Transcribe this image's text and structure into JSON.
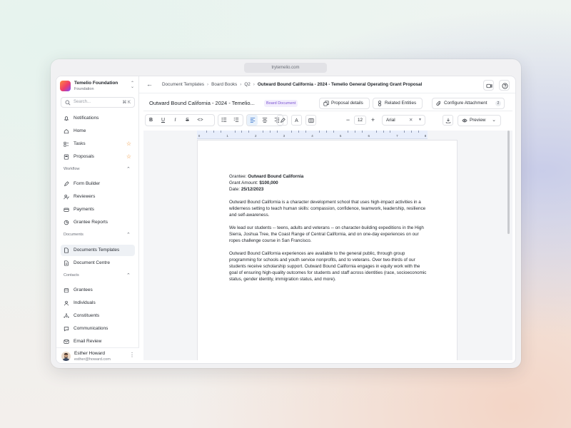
{
  "browser": {
    "url": "trytemelio.com"
  },
  "org": {
    "name": "Temelio Foundation",
    "subtitle": "Foundation"
  },
  "search": {
    "placeholder": "Search...",
    "shortcut": "⌘ K"
  },
  "sidebar": {
    "top_items": [
      {
        "label": "Notifications",
        "icon": "bell-icon"
      },
      {
        "label": "Home",
        "icon": "home-icon"
      },
      {
        "label": "Tasks",
        "icon": "tasks-icon",
        "starred": true
      },
      {
        "label": "Proposals",
        "icon": "proposals-icon",
        "starred": true
      }
    ],
    "sections": [
      {
        "title": "Workflow",
        "items": [
          {
            "label": "Form Builder",
            "icon": "form-builder-icon"
          },
          {
            "label": "Reviewers",
            "icon": "reviewers-icon"
          },
          {
            "label": "Payments",
            "icon": "payments-icon"
          },
          {
            "label": "Grantee Reports",
            "icon": "reports-icon"
          }
        ]
      },
      {
        "title": "Documents",
        "items": [
          {
            "label": "Documents Templates",
            "icon": "document-icon",
            "active": true
          },
          {
            "label": "Document Centre",
            "icon": "document-centre-icon"
          }
        ]
      },
      {
        "title": "Contacts",
        "items": [
          {
            "label": "Grantees",
            "icon": "grantees-icon"
          },
          {
            "label": "Individuals",
            "icon": "individuals-icon"
          },
          {
            "label": "Constituents",
            "icon": "constituents-icon"
          },
          {
            "label": "Communications",
            "icon": "communications-icon"
          },
          {
            "label": "Email Review",
            "icon": "email-icon"
          }
        ]
      }
    ]
  },
  "user": {
    "name": "Esther Howard",
    "email": "esther@howard.com"
  },
  "breadcrumb": [
    "Document Templates",
    "Board Books",
    "Q2",
    "Outward Bound California - 2024 - Temelio General Operating Grant Proposal"
  ],
  "document": {
    "title": "Outward Bound California - 2024 - Temelio...",
    "badge": "Board Document",
    "actions": {
      "proposal_details": "Proposal details",
      "related_entities": "Related Entities",
      "configure_attachment": "Configure Attachment",
      "attachment_count": "2"
    }
  },
  "toolbar": {
    "bold": "B",
    "underline": "U",
    "italic": "I",
    "strike": "S",
    "code": "<>",
    "text_color": "A",
    "font_size": "12",
    "font": "Arial",
    "preview": "Preview",
    "align_active": "left"
  },
  "ruler": {
    "labels": [
      "0",
      "1",
      "2",
      "3",
      "4",
      "5",
      "6",
      "7",
      "8"
    ]
  },
  "letter": {
    "grantee_label": "Grantee:",
    "grantee": "Outward Bound California",
    "amount_label": "Grant Amount:",
    "amount": "$100,000",
    "date_label": "Date:",
    "date": "25/12/2023",
    "paragraphs": [
      "Outward Bound California is a character development school that uses high-impact activities in a wilderness setting to teach human skills: compassion, confidence, teamwork, leadership, resilience and self-awareness.",
      "We lead our students -- teens, adults and veterans -- on character-building expeditions in the High Sierra, Joshua Tree, the Coast Range of Central California, and on one-day experiences on our ropes challenge course in San Francisco.",
      "Outward Bound California experiences are available to the general public, through group programming for schools and youth service nonprofits, and to veterans. Over two-thirds of our students receive scholarship support. Outward Bound California engages in equity work with the goal of ensuring high-quality outcomes for students and staff across identities (race, socioeconomic status, gender identity, immigration status, and more)."
    ]
  },
  "colors": {
    "accent": "#2d6cc9",
    "badge_bg": "#f3eefd",
    "badge_text": "#7a52d1",
    "star": "#f08a24",
    "active_nav": "#eef1f5"
  }
}
